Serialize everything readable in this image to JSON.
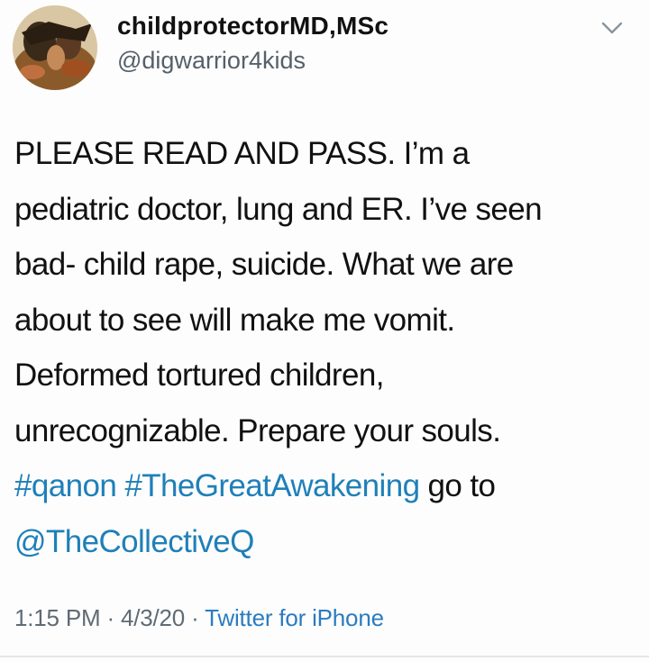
{
  "user": {
    "display_name": "childprotectorMD,MSc",
    "handle": "@digwarrior4kids"
  },
  "tweet": {
    "lines": [
      [
        "PLEASE READ AND PASS. I’m a"
      ],
      [
        "pediatric doctor, lung and ER. I’ve seen"
      ],
      [
        "bad- child rape, suicide. What we are"
      ],
      [
        "about to see will make me vomit."
      ],
      [
        "Deformed tortured children,"
      ],
      [
        "unrecognizable. Prepare your souls."
      ]
    ],
    "hashtag_1": "#qanon",
    "hashtag_2": "#TheGreatAwakening",
    "after_hashtags": " go to",
    "mention": "@TheCollectiveQ"
  },
  "meta": {
    "time": "1:15 PM",
    "separator": "·",
    "date": "4/3/20",
    "source": "Twitter for iPhone"
  },
  "icons": {
    "caret": "chevron-down-icon",
    "avatar": "avatar-image"
  },
  "colors": {
    "link": "#1f80b8",
    "muted": "#5f6b75"
  }
}
